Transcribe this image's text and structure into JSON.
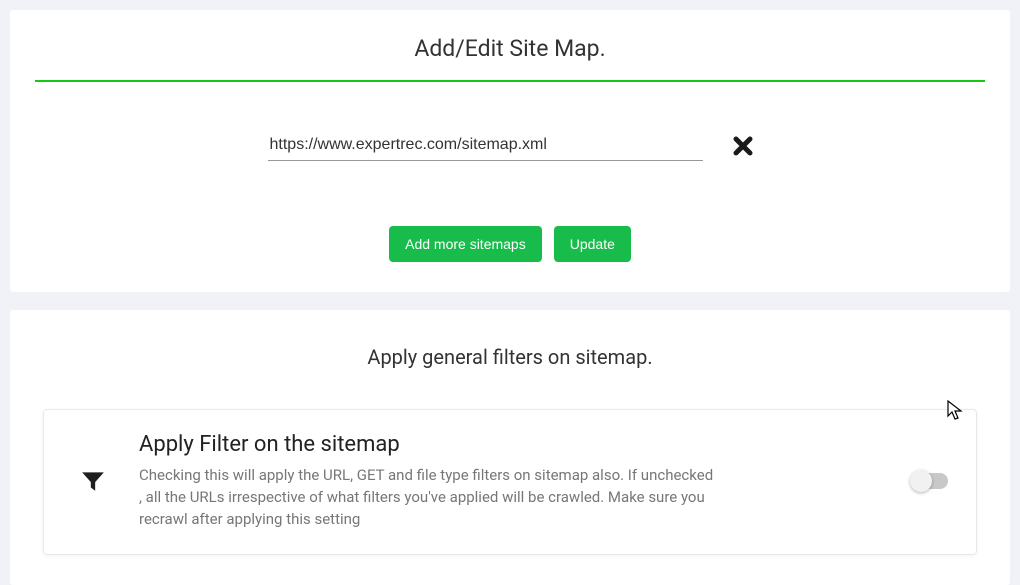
{
  "sitemap_card": {
    "title": "Add/Edit Site Map.",
    "input_value": "https://www.expertrec.com/sitemap.xml",
    "add_more_label": "Add more sitemaps",
    "update_label": "Update"
  },
  "filter_card": {
    "section_title": "Apply general filters on sitemap.",
    "heading": "Apply Filter on the sitemap",
    "description": "Checking this will apply the URL, GET and file type filters on sitemap also. If unchecked , all the URLs irrespective of what filters you've applied will be crawled. Make sure you recrawl after applying this setting",
    "toggle_on": false
  }
}
